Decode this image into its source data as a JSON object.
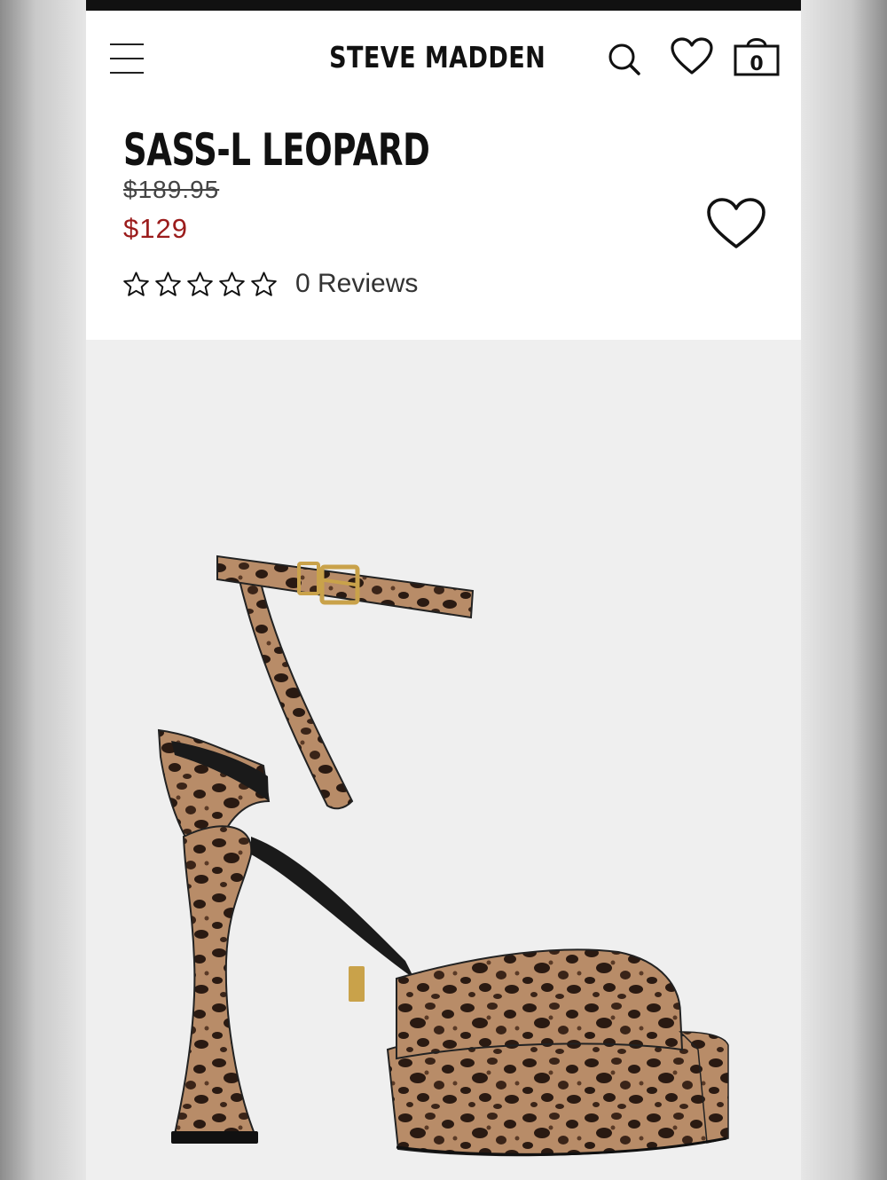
{
  "header": {
    "logo": "STEVE MADDEN",
    "bag_count": "0",
    "icons": {
      "menu": "hamburger-menu-icon",
      "search": "search-icon",
      "wishlist": "heart-icon",
      "bag": "shopping-bag-icon"
    }
  },
  "product": {
    "title": "SASS-L LEOPARD",
    "original_price": "$189.95",
    "sale_price": "$129",
    "rating": 0,
    "rating_max": 5,
    "reviews_label": "0 Reviews",
    "favorite_icon": "heart-outline-icon",
    "image_alt": "leopard print platform sandal with ankle strap"
  },
  "colors": {
    "sale_price": "#9b1c1c",
    "text": "#111111",
    "image_background": "#efefef",
    "leopard_base": "#b88c68",
    "leopard_spot": "#2a1a12",
    "buckle": "#c9a24a"
  }
}
